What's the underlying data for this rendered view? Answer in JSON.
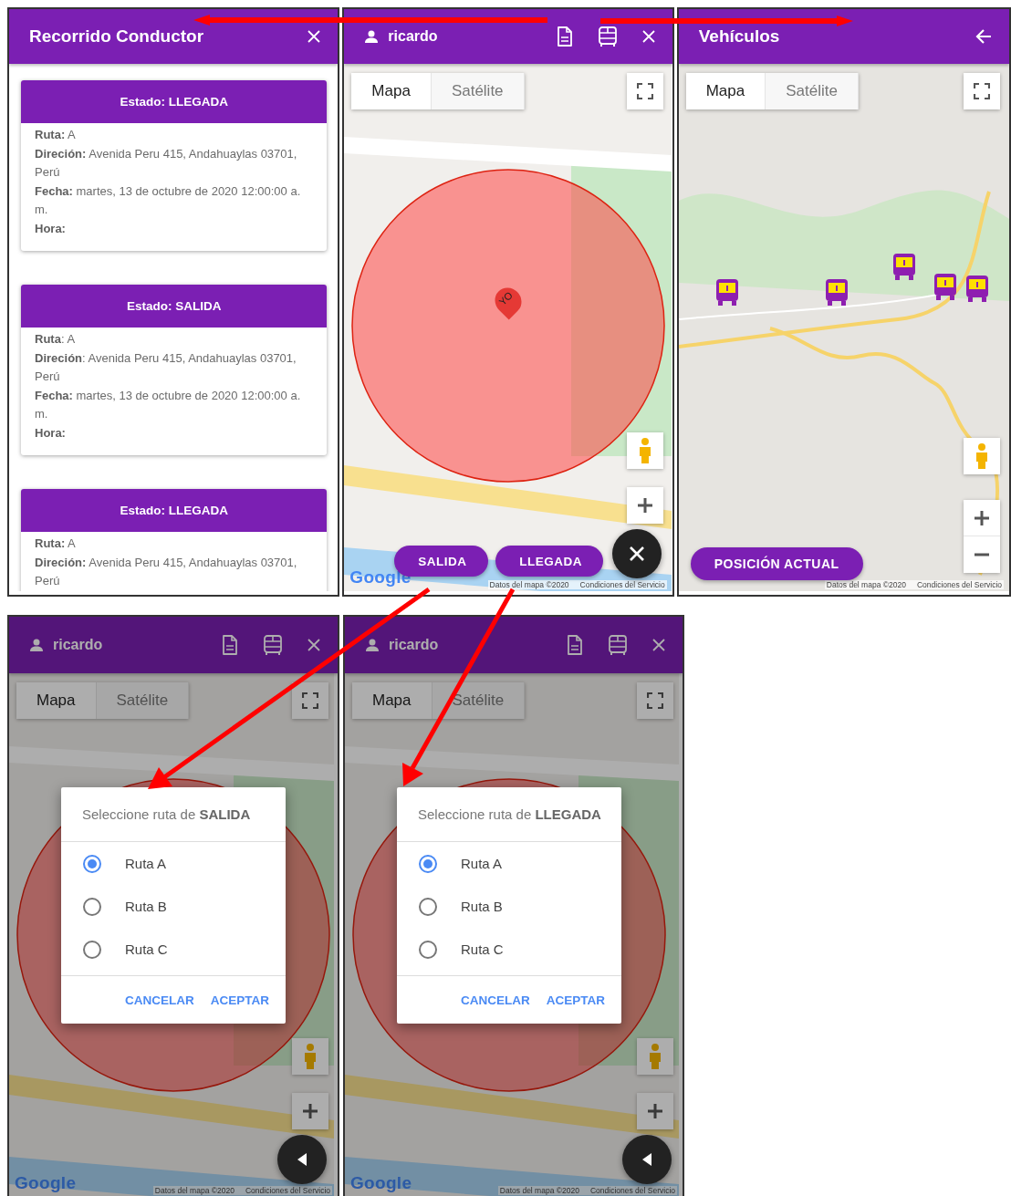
{
  "screens": [
    {
      "kind": "list",
      "title": "Recorrido Conductor",
      "cards": [
        {
          "status": "Estado: LLEGADA",
          "lines": [
            "**Ruta:** A",
            "**Direción:** Avenida Peru 415, Andahuaylas 03701, Perú",
            "**Fecha:** martes, 13 de octubre de 2020 12:00:00 a. m.",
            "**Hora:**"
          ]
        },
        {
          "status": "Estado: SALIDA",
          "lines": [
            "**Ruta**: A",
            "**Direción**: Avenida Peru 415, Andahuaylas 03701, Perú",
            "**Fecha:** martes, 13 de octubre de 2020 12:00:00 a. m.",
            "**Hora:**"
          ]
        },
        {
          "status": "Estado: LLEGADA",
          "lines": [
            "**Ruta:** A",
            "**Direción:** Avenida Peru 415, Andahuaylas 03701, Perú"
          ]
        }
      ]
    },
    {
      "kind": "map",
      "user": "ricardo",
      "map_types": [
        {
          "label": "Mapa",
          "selected": true
        },
        {
          "label": "Satélite",
          "selected": false
        }
      ],
      "marker": "YO",
      "actions": [
        "SALIDA",
        "LLEGADA"
      ],
      "logo": "Google",
      "attribution": [
        "Datos del mapa ©2020",
        "Condiciones del Servicio"
      ]
    },
    {
      "kind": "vehicles",
      "title": "Vehículos",
      "map_types": [
        {
          "label": "Mapa",
          "selected": true
        },
        {
          "label": "Satélite",
          "selected": false
        }
      ],
      "button": "POSICIÓN ACTUAL",
      "attribution": [
        "Datos del mapa ©2020",
        "Condiciones del Servicio"
      ]
    },
    {
      "kind": "dialog",
      "user": "ricardo",
      "map_types": [
        {
          "label": "Mapa",
          "selected": true
        },
        {
          "label": "Satélite",
          "selected": false
        }
      ],
      "logo": "Google",
      "attribution": [
        "Datos del mapa ©2020",
        "Condiciones del Servicio"
      ],
      "dialog": {
        "title": "Seleccione ruta de **SALIDA**",
        "options": [
          {
            "label": "Ruta A",
            "selected": true
          },
          {
            "label": "Ruta B",
            "selected": false
          },
          {
            "label": "Ruta C",
            "selected": false
          }
        ],
        "actions": [
          "CANCELAR",
          "ACEPTAR"
        ]
      }
    },
    {
      "kind": "dialog",
      "user": "ricardo",
      "map_types": [
        {
          "label": "Mapa",
          "selected": true
        },
        {
          "label": "Satélite",
          "selected": false
        }
      ],
      "logo": "Google",
      "attribution": [
        "Datos del mapa ©2020",
        "Condiciones del Servicio"
      ],
      "dialog": {
        "title": "Seleccione ruta de **LLEGADA**",
        "options": [
          {
            "label": "Ruta A",
            "selected": true
          },
          {
            "label": "Ruta B",
            "selected": false
          },
          {
            "label": "Ruta C",
            "selected": false
          }
        ],
        "actions": [
          "CANCELAR",
          "ACEPTAR"
        ]
      }
    }
  ]
}
